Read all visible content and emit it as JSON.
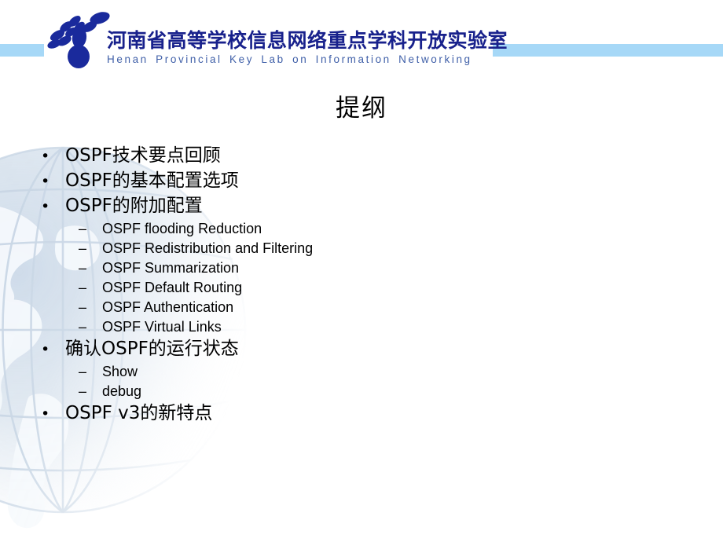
{
  "header": {
    "logo_icon": "network-cluster-logo-icon",
    "lab_name_cn": "河南省高等学校信息网络重点学科开放实验室",
    "lab_name_en": "Henan  Provincial  Key  Lab  on  Information  Networking",
    "accent_bar_color": "#a6d8f7",
    "logo_color": "#1a2a9c",
    "cn_text_color": "#18218c",
    "en_text_color": "#3f5fa8"
  },
  "slide": {
    "title": "提纲",
    "background_color": "#ffffff",
    "text_color": "#000000",
    "watermark_icon": "globe-wireframe-watermark-icon"
  },
  "outline": {
    "l1_marker": "•",
    "l2_marker": "–",
    "items": [
      {
        "level": 1,
        "text": "OSPF技术要点回顾"
      },
      {
        "level": 1,
        "text": "OSPF的基本配置选项"
      },
      {
        "level": 1,
        "text": "OSPF的附加配置"
      },
      {
        "level": 2,
        "text": "OSPF flooding Reduction"
      },
      {
        "level": 2,
        "text": "OSPF Redistribution and Filtering"
      },
      {
        "level": 2,
        "text": "OSPF Summarization"
      },
      {
        "level": 2,
        "text": "OSPF Default Routing"
      },
      {
        "level": 2,
        "text": "OSPF Authentication"
      },
      {
        "level": 2,
        "text": "OSPF Virtual Links"
      },
      {
        "level": 1,
        "text": "确认OSPF的运行状态"
      },
      {
        "level": 2,
        "text": "Show"
      },
      {
        "level": 2,
        "text": "debug"
      },
      {
        "level": 1,
        "text": "OSPF v3的新特点"
      }
    ]
  }
}
